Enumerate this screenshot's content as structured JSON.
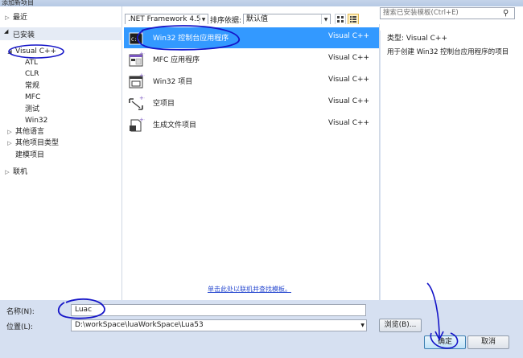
{
  "window": {
    "title": "添加新项目"
  },
  "tree": {
    "recent": "最近",
    "installed": "已安装",
    "visual_cpp": "Visual C++",
    "children": [
      "ATL",
      "CLR",
      "常规",
      "MFC",
      "测试",
      "Win32"
    ],
    "other_languages": "其他语言",
    "other_project_types": "其他项目类型",
    "modeling_projects": "建模项目",
    "online": "联机"
  },
  "toolbar": {
    "framework": ".NET Framework 4.5",
    "sort_label": "排序依据:",
    "sort_value": "默认值",
    "search_placeholder": "搜索已安装模板(Ctrl+E)"
  },
  "templates": [
    {
      "name": "Win32 控制台应用程序",
      "lang": "Visual C++",
      "icon": "console-app-icon",
      "selected": true
    },
    {
      "name": "MFC 应用程序",
      "lang": "Visual C++",
      "icon": "mfc-app-icon",
      "selected": false
    },
    {
      "name": "Win32 项目",
      "lang": "Visual C++",
      "icon": "win32-project-icon",
      "selected": false
    },
    {
      "name": "空项目",
      "lang": "Visual C++",
      "icon": "empty-project-icon",
      "selected": false
    },
    {
      "name": "生成文件项目",
      "lang": "Visual C++",
      "icon": "makefile-project-icon",
      "selected": false
    }
  ],
  "online_link": "单击此处以联机并查找模板。",
  "description": {
    "type_line": "类型:  Visual C++",
    "text": "用于创建 Win32 控制台应用程序的项目"
  },
  "form": {
    "name_label": "名称(N):",
    "name_value": "Luac",
    "location_label": "位置(L):",
    "location_value": "D:\\workSpace\\luaWorkSpace\\Lua53",
    "browse": "浏览(B)...",
    "ok": "确定",
    "cancel": "取消"
  },
  "colors": {
    "selection": "#3399ff",
    "annotation": "#1515c8",
    "link": "#2a4bd0"
  }
}
